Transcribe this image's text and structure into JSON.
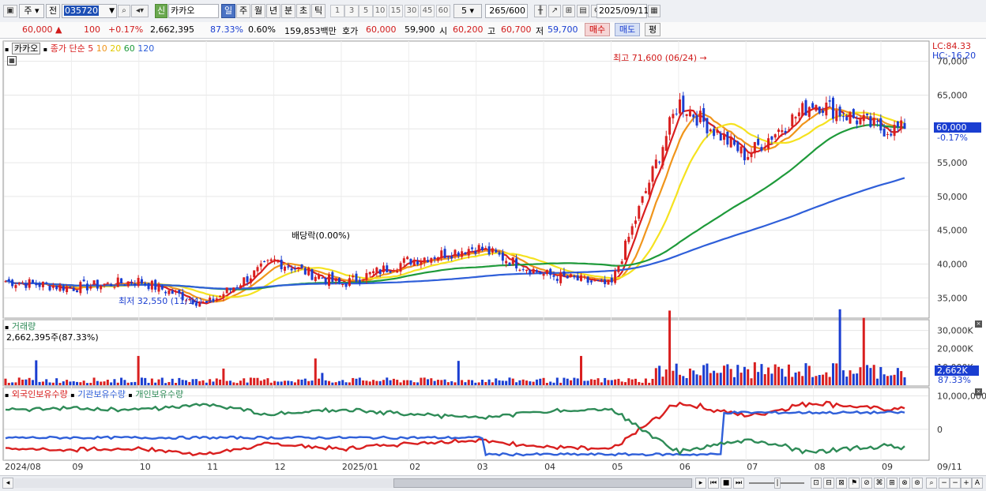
{
  "toolbar": {
    "stock_type": "주",
    "prev_label": "전",
    "stock_code": "035720",
    "badge_new": "신",
    "stock_name": "카카오",
    "periods": [
      "일",
      "주",
      "월",
      "년",
      "분",
      "초",
      "틱"
    ],
    "active_period": "일",
    "intervals": [
      "1",
      "3",
      "5",
      "10",
      "15",
      "30",
      "45",
      "60"
    ],
    "interval_select": "5",
    "count": "265",
    "count_total": "/600",
    "date": "2025/09/11"
  },
  "quote": {
    "price": "60,000",
    "change": "100",
    "change_pct": "+0.17%",
    "volume": "2,662,395",
    "volume_ratio": "87.33%",
    "turnover_pct": "0.60%",
    "amount": "159,853백만",
    "bid_label": "호가",
    "ask_price": "60,000",
    "bid_price": "59,900",
    "open_label": "시",
    "open": "60,200",
    "high_label": "고",
    "high": "60,700",
    "low_label": "저",
    "low": "59,700",
    "buy_button": "매수",
    "sell_button": "매도",
    "eval_button": "평"
  },
  "price_panel": {
    "stock_tab": "카카오",
    "legend_prefix": "종가 단순",
    "ma_periods": [
      "5",
      "10",
      "20",
      "60",
      "120"
    ],
    "ma_colors": [
      "#d91f1f",
      "#f0951b",
      "#f5e21f",
      "#1e9a3a",
      "#2f5fd9"
    ],
    "lc_label": "LC:84.33",
    "hc_label": "HC:-16.20",
    "high_annotation": "최고 71,600 (06/24)",
    "low_annotation": "최저 32,550 (11/14)",
    "ex_rights_annotation": "배당락(0.00%)",
    "y_ticks": [
      "70,000",
      "65,000",
      "60,000",
      "55,000",
      "50,000",
      "45,000",
      "40,000",
      "35,000"
    ],
    "current_price_tag": "60,000",
    "current_change_tag": "-0.17%",
    "up_color": "#d91f1f",
    "down_color": "#1a3ed1"
  },
  "volume_panel": {
    "title": "거래량",
    "value_text": "2,662,395주(87.33%)",
    "y_ticks": [
      "30,000K",
      "20,000K",
      "10,000K"
    ],
    "current_tag": "2,662K",
    "current_ratio": "87.33%"
  },
  "holdings_panel": {
    "legend": [
      "외국인보유수량",
      "기관보유수량",
      "개인보유수량"
    ],
    "legend_colors": [
      "#d91f1f",
      "#2f5fd9",
      "#2e8b57"
    ],
    "y_ticks": [
      "10,000,000",
      "0"
    ]
  },
  "x_axis": {
    "labels": [
      "2024/08",
      "09",
      "10",
      "11",
      "12",
      "2025/01",
      "02",
      "03",
      "04",
      "05",
      "06",
      "07",
      "08",
      "09"
    ],
    "right_label": "09/11"
  },
  "chart_data": {
    "type": "candlestick",
    "title": "",
    "y_range": [
      32000,
      73000
    ],
    "high_point": 71600,
    "low_point": 32550,
    "last_close": 60000,
    "volume_range_k": [
      0,
      35000
    ],
    "holdings_range": [
      -9000000,
      12000000
    ],
    "monthly_close": [
      {
        "month": "2024/08",
        "close": 37500
      },
      {
        "month": "09",
        "close": 36500
      },
      {
        "month": "10",
        "close": 37500
      },
      {
        "month": "11",
        "close": 34000
      },
      {
        "month": "12",
        "close": 40500
      },
      {
        "month": "2025/01",
        "close": 37000
      },
      {
        "month": "02",
        "close": 40500
      },
      {
        "month": "03",
        "close": 42500
      },
      {
        "month": "04",
        "close": 38500
      },
      {
        "month": "05",
        "close": 36800
      },
      {
        "month": "06",
        "close": 64000
      },
      {
        "month": "07",
        "close": 56000
      },
      {
        "month": "08",
        "close": 64000
      },
      {
        "month": "09",
        "close": 60000
      }
    ]
  }
}
